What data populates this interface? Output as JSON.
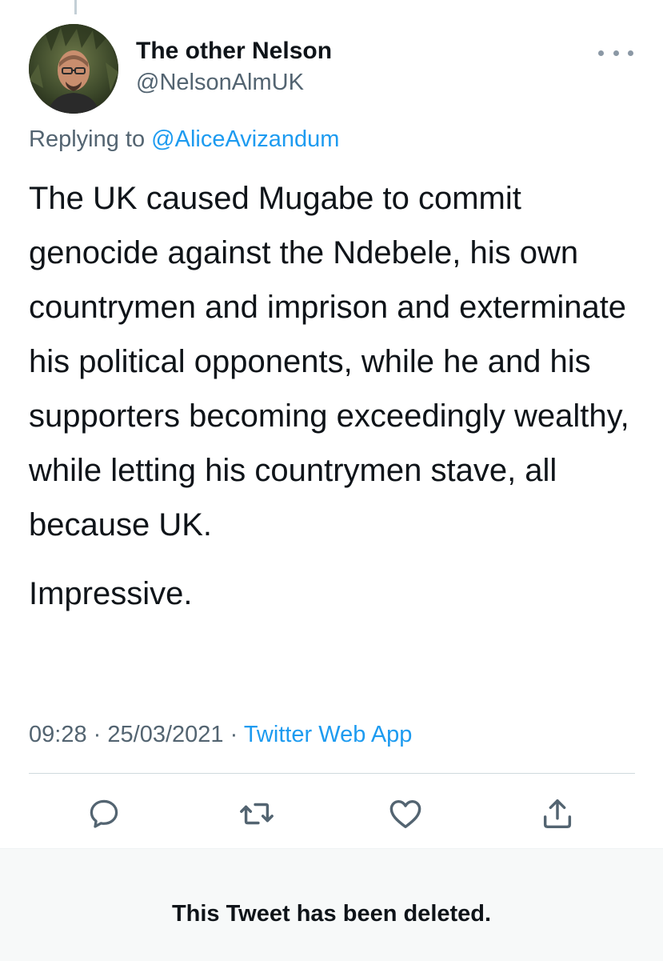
{
  "tweet": {
    "author": {
      "display_name": "The other Nelson",
      "handle": "@NelsonAlmUK"
    },
    "replying_to_prefix": "Replying to",
    "replying_to_handle": "@AliceAvizandum",
    "text_paragraph_1": "The UK caused Mugabe to commit genocide against the Ndebele, his own countrymen and imprison and exterminate his political opponents, while he and his supporters becoming exceedingly wealthy, while letting his countrymen stave, all because UK.",
    "text_paragraph_2": "Impressive.",
    "time": "09:28",
    "date": "25/03/2021",
    "separator": "·",
    "source": "Twitter Web App"
  },
  "actions": {
    "reply_icon": "reply-icon",
    "retweet_icon": "retweet-icon",
    "like_icon": "heart-icon",
    "share_icon": "share-icon",
    "more_icon": "more-options-icon"
  },
  "deleted_notice": "This Tweet has been deleted.",
  "colors": {
    "accent": "#1d9bf0",
    "secondary_text": "#536471",
    "primary_text": "#0f1419",
    "icon": "#536471",
    "divider": "#cfd9de",
    "notice_background": "#f7f9f9"
  }
}
